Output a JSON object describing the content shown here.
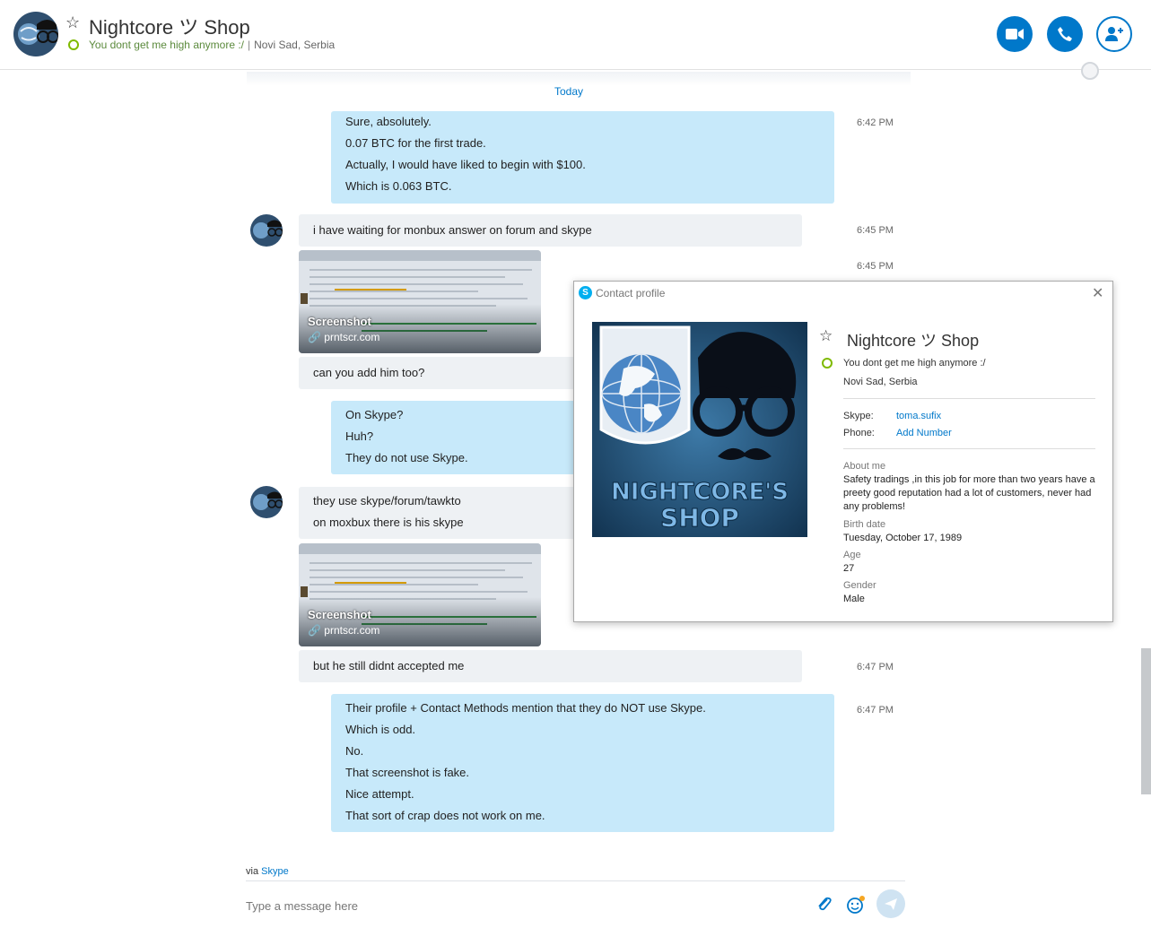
{
  "header": {
    "title": "Nightcore ツ Shop",
    "mood": "You dont get me high anymore :/",
    "separator": "|",
    "location": "Novi Sad, Serbia"
  },
  "chat": {
    "today_label": "Today",
    "messages": [
      {
        "dir": "out",
        "lines": [
          "Sure, absolutely.",
          "0.07 BTC for the first trade.",
          "Actually, I would have liked to begin with $100.",
          "Which is 0.063 BTC."
        ],
        "time": "6:42 PM"
      },
      {
        "dir": "in",
        "lines": [
          "i have waiting for monbux answer on forum and skype"
        ],
        "time": "6:45 PM"
      },
      {
        "dir": "in",
        "type": "link",
        "caption": "Screenshot",
        "domain": "prntscr.com",
        "time": "6:45 PM"
      },
      {
        "dir": "in",
        "lines": [
          "can you add him too?"
        ]
      },
      {
        "dir": "out",
        "lines": [
          "On Skype?",
          "Huh?",
          "They do not use Skype."
        ]
      },
      {
        "dir": "in",
        "lines": [
          "they use skype/forum/tawkto",
          "on moxbux there is his skype"
        ]
      },
      {
        "dir": "in",
        "type": "link",
        "caption": "Screenshot",
        "domain": "prntscr.com"
      },
      {
        "dir": "in",
        "lines": [
          "but he still didnt accepted me"
        ],
        "time": "6:47 PM"
      },
      {
        "dir": "out",
        "lines": [
          "Their profile + Contact Methods mention that they do NOT use Skype.",
          "Which is odd.",
          "No.",
          "That screenshot is fake.",
          "Nice attempt.",
          "That sort of crap does not work on me."
        ],
        "time": "6:47 PM"
      }
    ]
  },
  "footer": {
    "via_prefix": "via",
    "via_link": "Skype",
    "input_placeholder": "Type a message here"
  },
  "popup": {
    "title": "Contact profile",
    "logo_text_1": "NIGHTCORE'S",
    "logo_text_2": "SHOP",
    "name": "Nightcore ツ Shop",
    "mood": "You dont get me high anymore :/",
    "location": "Novi Sad, Serbia",
    "skype_label": "Skype:",
    "skype_value": "toma.sufix",
    "phone_label": "Phone:",
    "phone_value": "Add Number",
    "about_label": "About me",
    "about_text": "Safety tradings ,in this job for more than two years have a preety good reputation had a lot of customers, never had any problems!",
    "birth_label": "Birth date",
    "birth_value": "Tuesday, October 17, 1989",
    "age_label": "Age",
    "age_value": "27",
    "gender_label": "Gender",
    "gender_value": "Male"
  },
  "colors": {
    "accent": "#0078ca",
    "bubble_out": "#c7e9fa",
    "bubble_in": "#eef1f4",
    "online": "#7fba00"
  }
}
